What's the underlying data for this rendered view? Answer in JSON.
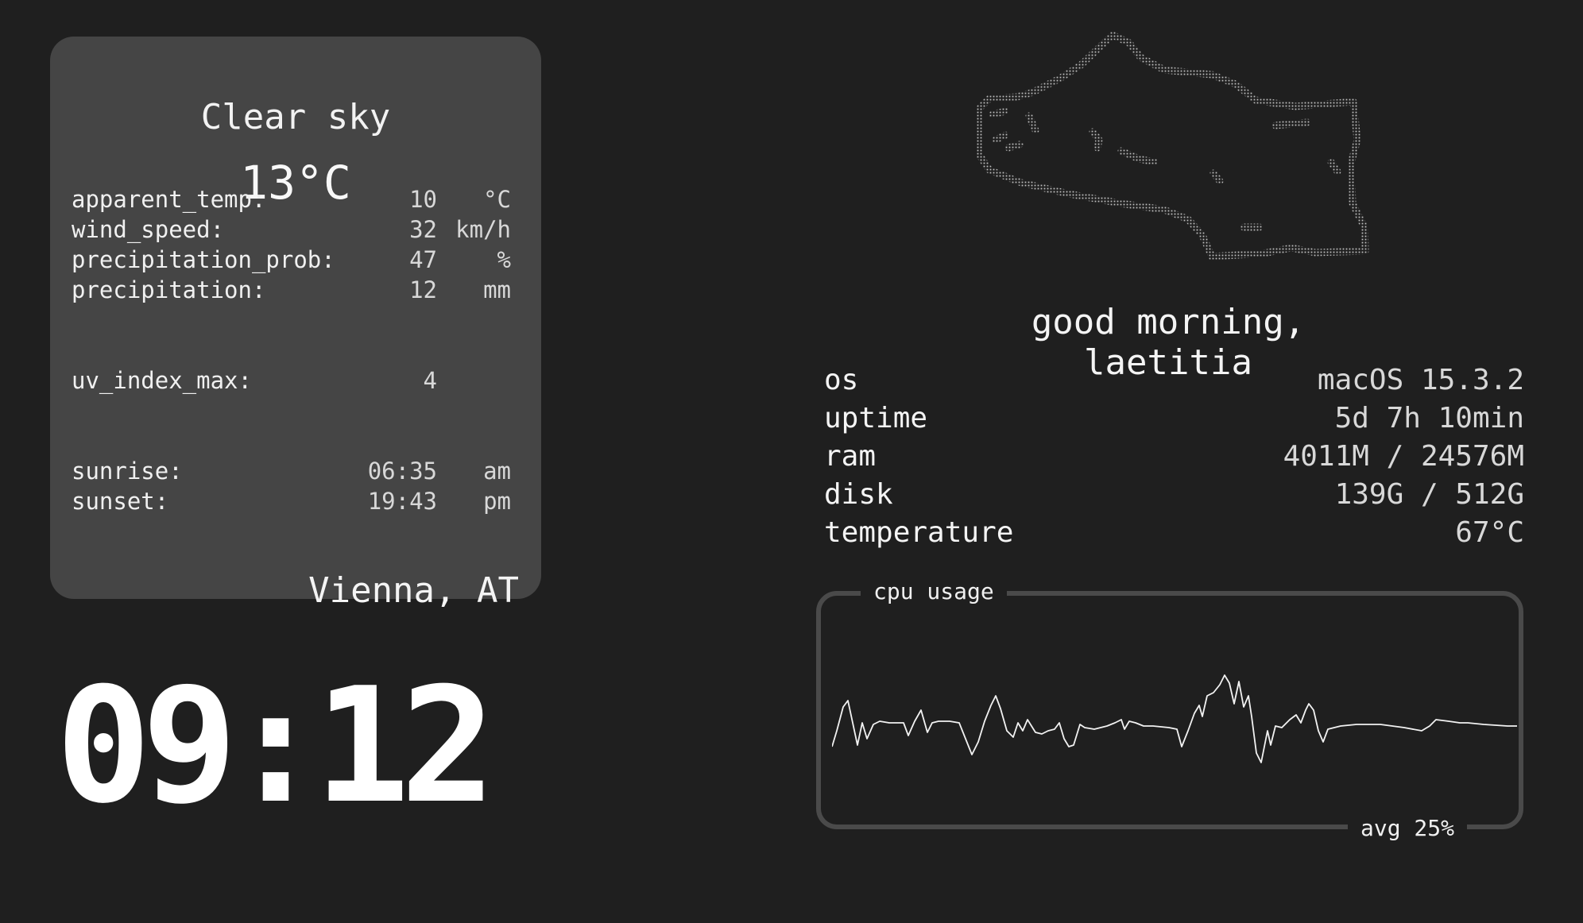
{
  "weather": {
    "condition": "Clear sky",
    "temperature": "13°C",
    "rows": [
      {
        "label": "apparent_temp:",
        "value": "10",
        "unit": "°C"
      },
      {
        "label": "wind_speed:",
        "value": "32",
        "unit": "km/h"
      },
      {
        "label": "precipitation_prob:",
        "value": "47",
        "unit": "%"
      },
      {
        "label": "precipitation:",
        "value": "12",
        "unit": "mm"
      },
      {
        "label": "uv_index_max:",
        "value": "4",
        "unit": ""
      },
      {
        "label": "sunrise:",
        "value": "06:35",
        "unit": "am"
      },
      {
        "label": "sunset:",
        "value": "19:43",
        "unit": "pm"
      }
    ],
    "location": "Vienna, AT"
  },
  "clock": {
    "time": "09:12"
  },
  "greeting": "good morning, laetitia",
  "system": {
    "rows": [
      {
        "key": "os",
        "value": "macOS 15.3.2"
      },
      {
        "key": "uptime",
        "value": "5d 7h 10min"
      },
      {
        "key": "ram",
        "value": "4011M / 24576M"
      },
      {
        "key": "disk",
        "value": "139G / 512G"
      },
      {
        "key": "temperature",
        "value": "67°C"
      }
    ]
  },
  "cpu": {
    "title": "cpu usage",
    "average": "avg 25%"
  },
  "colors": {
    "background": "#1f1f1f",
    "card": "#454545",
    "panel_border": "#4a4a4a",
    "text": "#f0f0f0"
  }
}
